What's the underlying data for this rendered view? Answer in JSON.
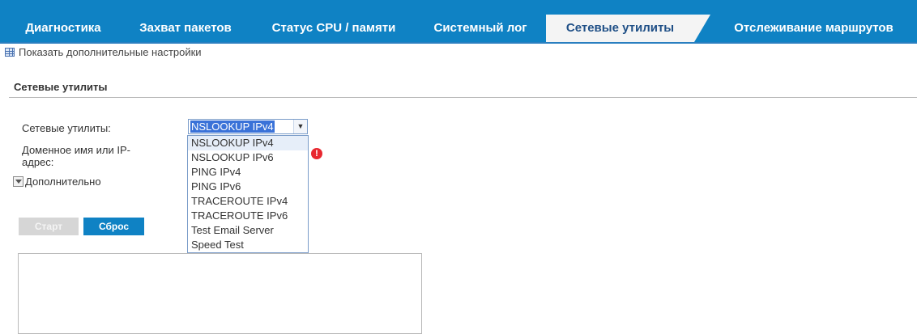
{
  "tabs": [
    {
      "label": "Диагностика"
    },
    {
      "label": "Захват пакетов"
    },
    {
      "label": "Статус CPU / памяти"
    },
    {
      "label": "Системный лог"
    },
    {
      "label": "Сетевые утилиты",
      "active": true
    },
    {
      "label": "Отслеживание маршрутов"
    }
  ],
  "advanced_link": "Показать дополнительные настройки",
  "section": {
    "title": "Сетевые утилиты"
  },
  "form": {
    "utility_label": "Сетевые утилиты:",
    "utility_selected": "NSLOOKUP IPv4",
    "host_label_line1": "Доменное имя или IP-",
    "host_label_line2": "адрес:",
    "advanced_toggle": "Дополнительно",
    "error_glyph": "!"
  },
  "dropdown_options": [
    "NSLOOKUP IPv4",
    "NSLOOKUP IPv6",
    "PING IPv4",
    "PING IPv6",
    "TRACEROUTE IPv4",
    "TRACEROUTE IPv6",
    "Test Email Server",
    "Speed Test"
  ],
  "buttons": {
    "start": "Старт",
    "reset": "Сброс"
  },
  "colors": {
    "tab_bar": "#0f82c4",
    "active_tab_bg": "#f4f4f4",
    "active_tab_text": "#1f4f86",
    "selection": "#3a72d8",
    "error": "#e8272f"
  }
}
